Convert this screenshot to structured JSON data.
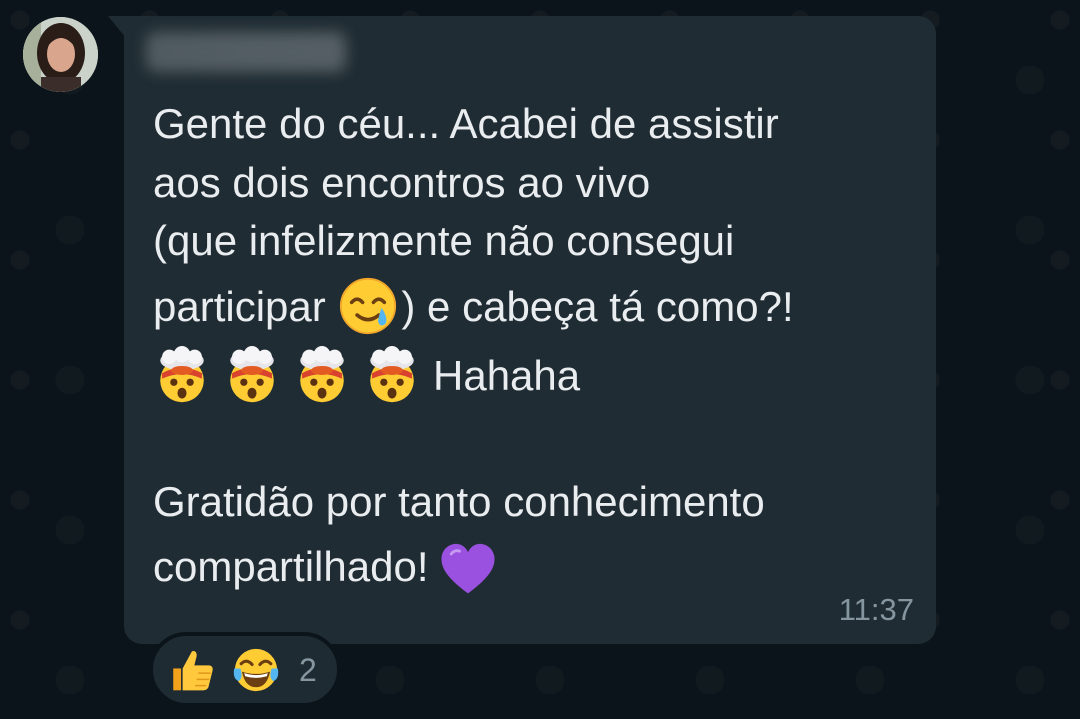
{
  "chat": {
    "sender_name": "",
    "message": {
      "line1": "Gente do céu... Acabei de assistir",
      "line2": "aos dois encontros ao vivo",
      "line3": "(que infelizmente não consegui",
      "line4_before": "participar ",
      "line4_after": ") e cabeça tá como?!",
      "line5_text": "Hahaha",
      "line7": "Gratidão por tanto conhecimento",
      "line8": "compartilhado!"
    },
    "emojis": {
      "line4": "smiling-face-with-tear",
      "line5": [
        "exploding-head",
        "exploding-head",
        "exploding-head",
        "exploding-head"
      ],
      "line8": "purple-heart"
    },
    "timestamp": "11:37",
    "reactions": {
      "emojis": [
        "thumbs-up",
        "face-with-tears-of-joy"
      ],
      "count": "2"
    }
  },
  "colors": {
    "background": "#0b141a",
    "bubble": "#202c33",
    "text": "#e9edef",
    "meta_text": "#8696a0"
  }
}
